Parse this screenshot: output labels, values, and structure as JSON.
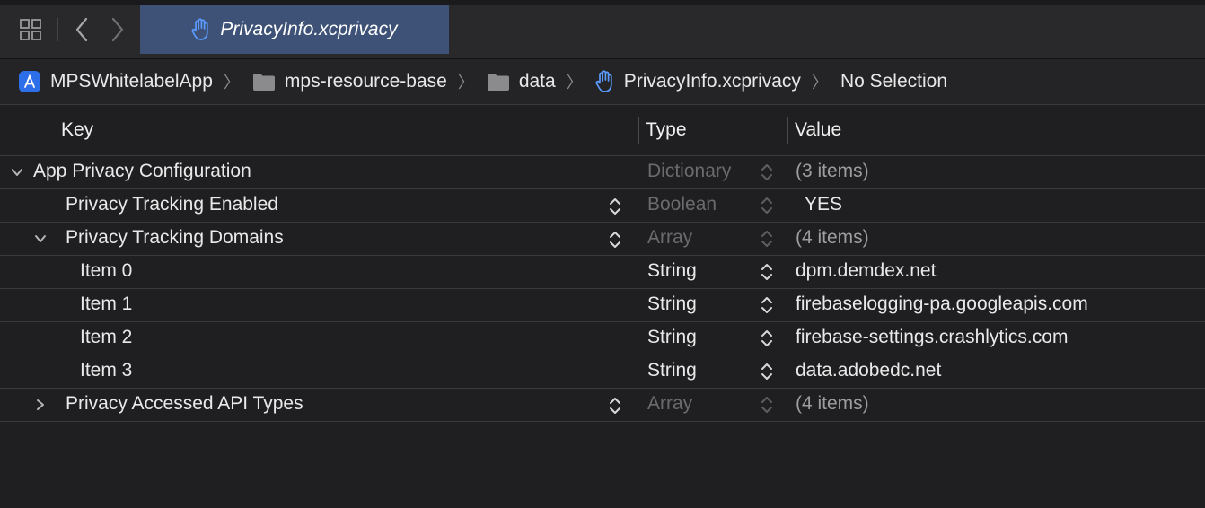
{
  "tabbar": {
    "active_tab_title": "PrivacyInfo.xcprivacy"
  },
  "pathbar": {
    "crumbs": [
      {
        "label": "MPSWhitelabelApp",
        "icon": "app-project-icon"
      },
      {
        "label": "mps-resource-base",
        "icon": "folder-icon"
      },
      {
        "label": "data",
        "icon": "folder-icon"
      },
      {
        "label": "PrivacyInfo.xcprivacy",
        "icon": "hand-privacy-icon"
      },
      {
        "label": "No Selection",
        "icon": ""
      }
    ]
  },
  "columns": {
    "key": "Key",
    "type": "Type",
    "value": "Value"
  },
  "rows": [
    {
      "key": "App Privacy Configuration",
      "type": "Dictionary",
      "value": "(3 items)"
    },
    {
      "key": "Privacy Tracking Enabled",
      "type": "Boolean",
      "value": "YES"
    },
    {
      "key": "Privacy Tracking Domains",
      "type": "Array",
      "value": "(4 items)"
    },
    {
      "key": "Item 0",
      "type": "String",
      "value": "dpm.demdex.net"
    },
    {
      "key": "Item 1",
      "type": "String",
      "value": "firebaselogging-pa.googleapis.com"
    },
    {
      "key": "Item 2",
      "type": "String",
      "value": "firebase-settings.crashlytics.com"
    },
    {
      "key": "Item 3",
      "type": "String",
      "value": "data.adobedc.net"
    },
    {
      "key": "Privacy Accessed API Types",
      "type": "Array",
      "value": "(4 items)"
    }
  ],
  "colors": {
    "active_tab": "#3d5276",
    "background": "#1f1f21",
    "accent_icon": "#4a8cf7"
  }
}
